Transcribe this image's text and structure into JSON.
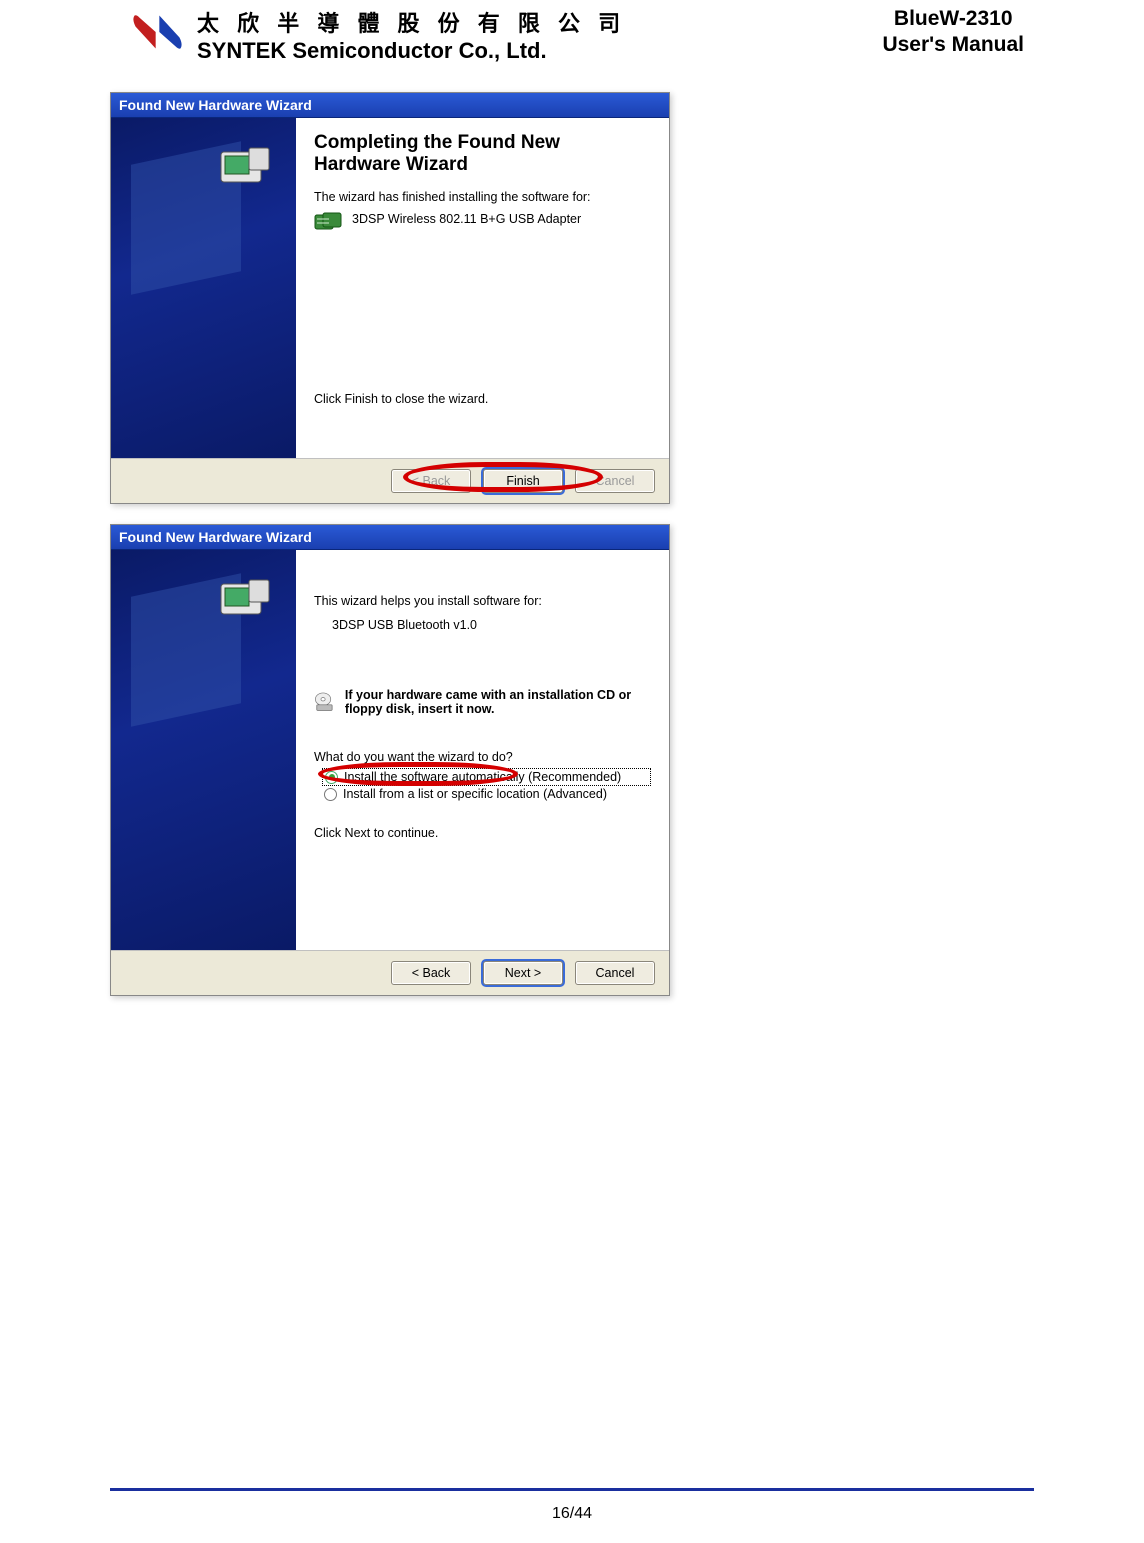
{
  "header": {
    "company_zh": "太 欣 半 導 體 股 份 有 限 公 司",
    "company_en": "SYNTEK Semiconductor Co., Ltd.",
    "product": "BlueW-2310",
    "manual": "User's Manual"
  },
  "wizard1": {
    "title": "Found New Hardware Wizard",
    "heading": "Completing the Found New Hardware Wizard",
    "finished_text": "The wizard has finished installing the software for:",
    "device": "3DSP Wireless 802.11 B+G USB Adapter",
    "close_text": "Click Finish to close the wizard.",
    "btn_back": "< Back",
    "btn_finish": "Finish",
    "btn_cancel": "Cancel"
  },
  "wizard2": {
    "title": "Found New Hardware Wizard",
    "intro": "This wizard helps you install software for:",
    "device": "3DSP USB Bluetooth v1.0",
    "cd_hint": "If your hardware came with an installation CD or floppy disk, insert it now.",
    "prompt": "What do you want the wizard to do?",
    "radio1": "Install the software automatically (Recommended)",
    "radio2": "Install from a list or specific location (Advanced)",
    "next_text": "Click Next to continue.",
    "btn_back": "< Back",
    "btn_next": "Next >",
    "btn_cancel": "Cancel"
  },
  "footer": {
    "page": "16/44"
  }
}
